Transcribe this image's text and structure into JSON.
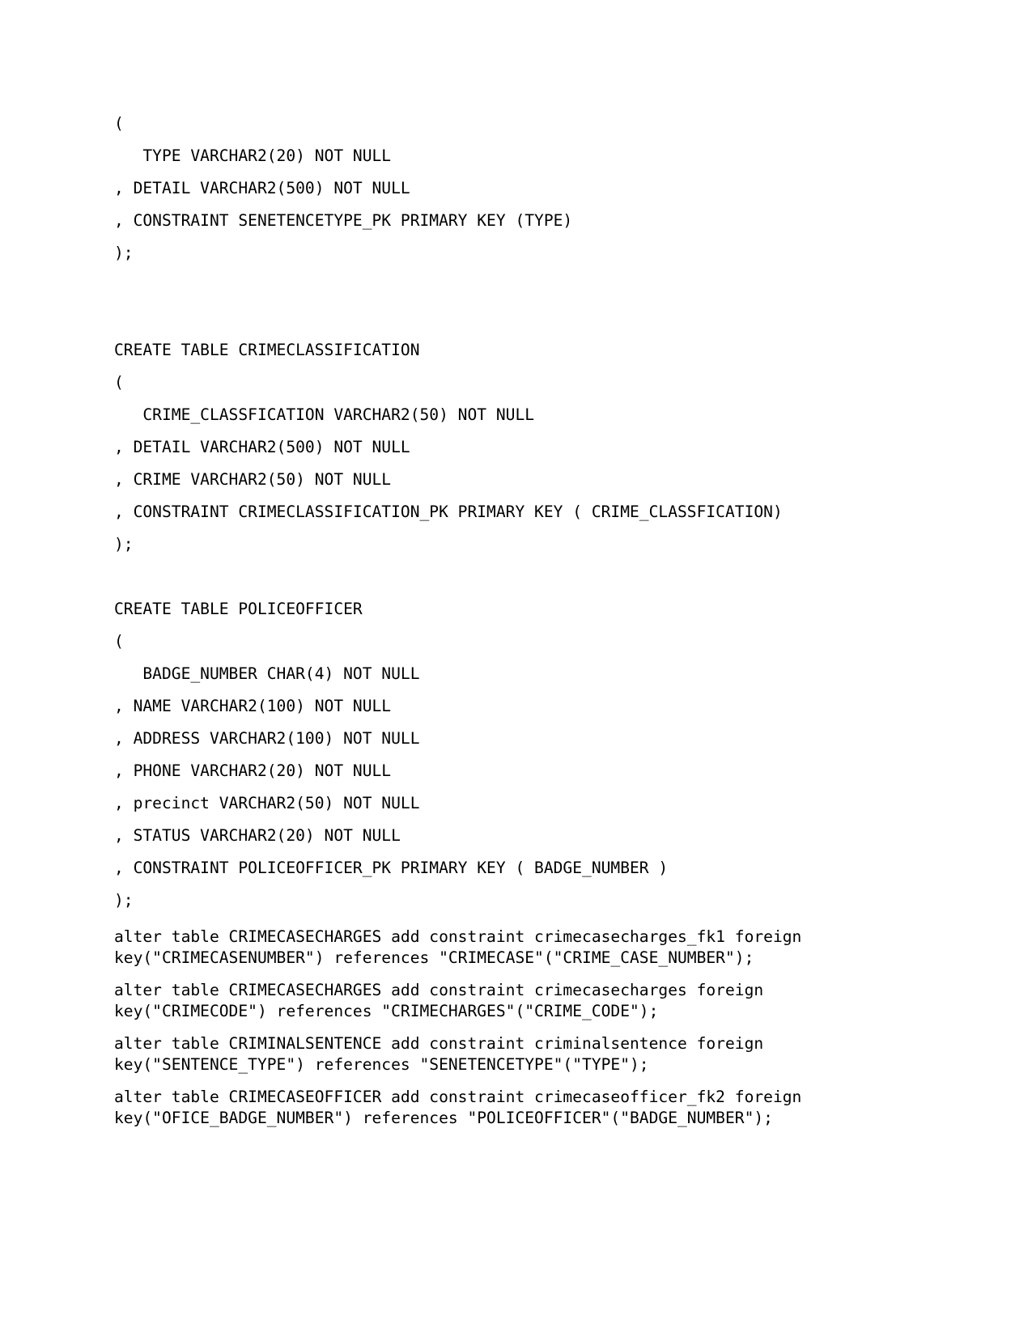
{
  "document": {
    "type": "sql-ddl-listing",
    "background_color": "#ffffff",
    "text_color": "#000000",
    "create_table_lines": [
      "(",
      "   TYPE VARCHAR2(20) NOT NULL",
      ", DETAIL VARCHAR2(500) NOT NULL",
      ", CONSTRAINT SENETENCETYPE_PK PRIMARY KEY (TYPE)",
      ");",
      "",
      "",
      "CREATE TABLE CRIMECLASSIFICATION",
      "(",
      "   CRIME_CLASSFICATION VARCHAR2(50) NOT NULL",
      ", DETAIL VARCHAR2(500) NOT NULL",
      ", CRIME VARCHAR2(50) NOT NULL",
      ", CONSTRAINT CRIMECLASSIFICATION_PK PRIMARY KEY ( CRIME_CLASSFICATION)",
      ");",
      "",
      "CREATE TABLE POLICEOFFICER",
      "(",
      "   BADGE_NUMBER CHAR(4) NOT NULL",
      ", NAME VARCHAR2(100) NOT NULL",
      ", ADDRESS VARCHAR2(100) NOT NULL",
      ", PHONE VARCHAR2(20) NOT NULL",
      ", precinct VARCHAR2(50) NOT NULL",
      ", STATUS VARCHAR2(20) NOT NULL",
      ", CONSTRAINT POLICEOFFICER_PK PRIMARY KEY ( BADGE_NUMBER )",
      ");"
    ],
    "alter_statements": [
      "alter table CRIMECASECHARGES add constraint crimecasecharges_fk1 foreign key(\"CRIMECASENUMBER\") references \"CRIMECASE\"(\"CRIME_CASE_NUMBER\");",
      "alter table CRIMECASECHARGES add constraint crimecasecharges foreign key(\"CRIMECODE\") references \"CRIMECHARGES\"(\"CRIME_CODE\");",
      "alter table CRIMINALSENTENCE add constraint criminalsentence foreign key(\"SENTENCE_TYPE\") references \"SENETENCETYPE\"(\"TYPE\");",
      "alter table CRIMECASEOFFICER add constraint crimecaseofficer_fk2 foreign key(\"OFICE_BADGE_NUMBER\") references \"POLICEOFFICER\"(\"BADGE_NUMBER\");"
    ]
  }
}
